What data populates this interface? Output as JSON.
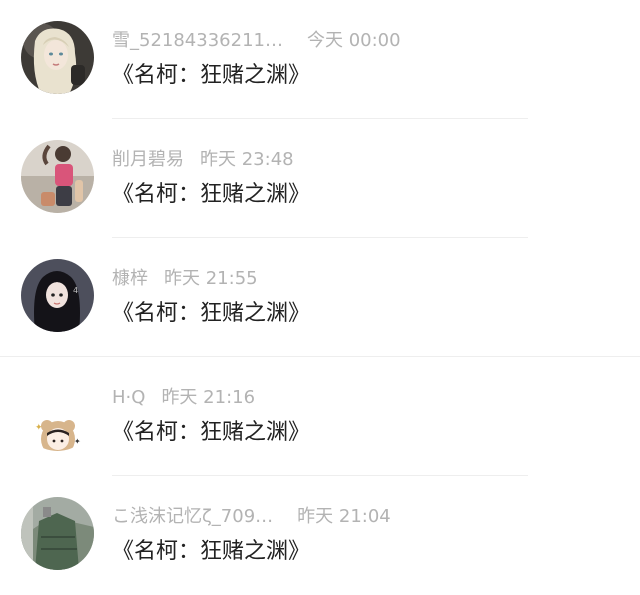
{
  "comments": [
    {
      "username": "雪_52184336211…",
      "time": "今天 00:00",
      "text": "《名柯：狂赌之渊》",
      "avatar_icon": "avatar-blonde-girl-illustration"
    },
    {
      "username": "削月碧易",
      "time": "昨天 23:48",
      "text": "《名柯：狂赌之渊》",
      "avatar_icon": "avatar-beach-photo"
    },
    {
      "username": "槺梓",
      "time": "昨天 21:55",
      "text": "《名柯：狂赌之渊》",
      "avatar_icon": "avatar-dark-hair-girl"
    },
    {
      "username": "H·Q",
      "time": "昨天 21:16",
      "text": "《名柯：狂赌之渊》",
      "avatar_icon": "avatar-bear-hood-cartoon"
    },
    {
      "username": "こ浅沫记忆ζ_709…",
      "time": "昨天 21:04",
      "text": "《名柯：狂赌之渊》",
      "avatar_icon": "avatar-green-dress-photo"
    }
  ]
}
